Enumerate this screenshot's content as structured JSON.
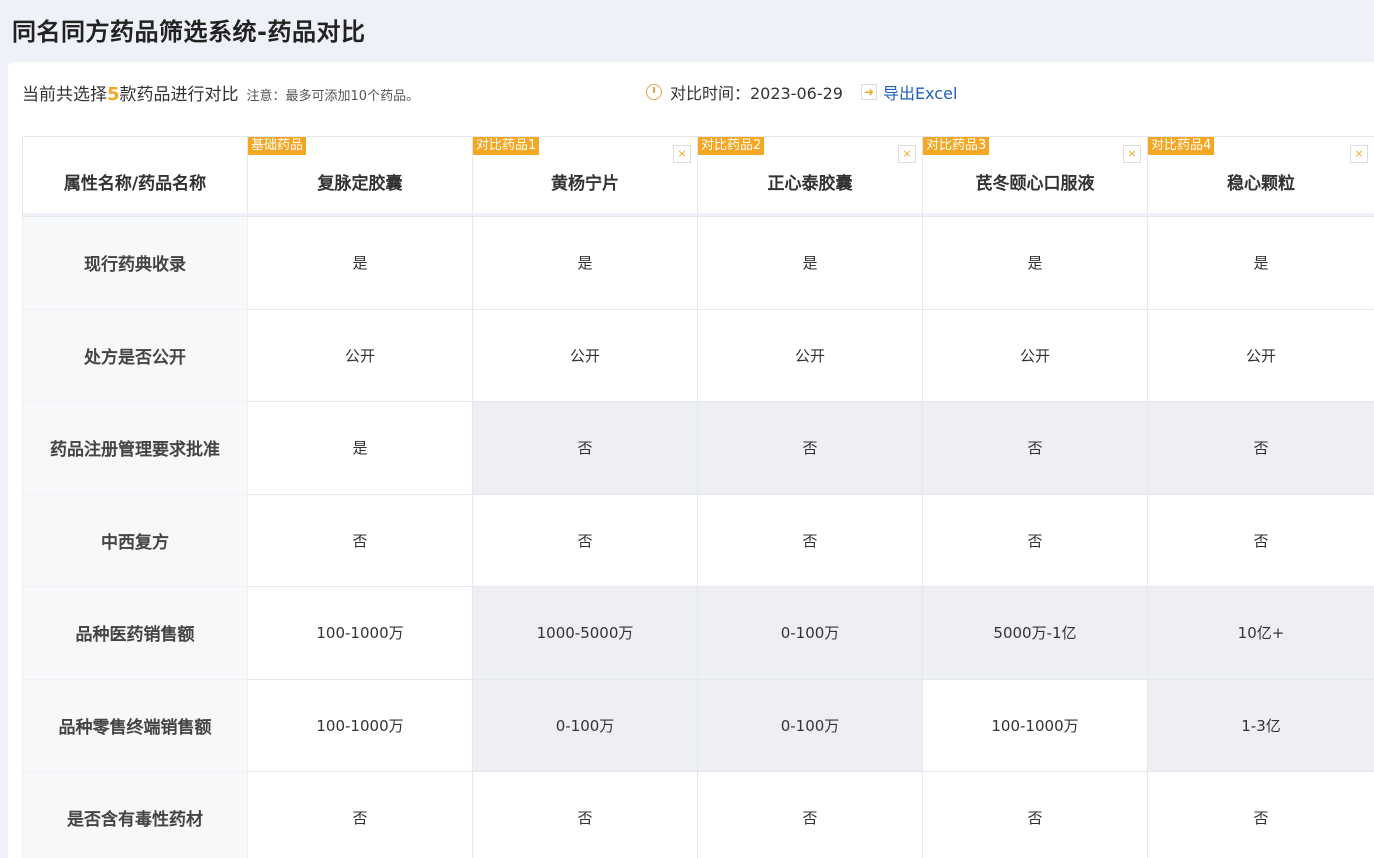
{
  "page_title": "同名同方药品筛选系统-药品对比",
  "info": {
    "prefix": "当前共选择",
    "count": "5",
    "suffix": "款药品进行对比",
    "note": "注意：最多可添加10个药品。",
    "time_label": "对比时间：2023-06-29",
    "export_label": "导出Excel"
  },
  "table": {
    "attr_header": "属性名称/药品名称",
    "drugs": [
      {
        "tag": "基础药品",
        "name": "复脉定胶囊",
        "removable": false
      },
      {
        "tag": "对比药品1",
        "name": "黄杨宁片",
        "removable": true
      },
      {
        "tag": "对比药品2",
        "name": "正心泰胶囊",
        "removable": true
      },
      {
        "tag": "对比药品3",
        "name": "芪冬颐心口服液",
        "removable": true
      },
      {
        "tag": "对比药品4",
        "name": "稳心颗粒",
        "removable": true
      }
    ],
    "close_symbol": "×",
    "rows": [
      {
        "label": "现行药典收录",
        "values": [
          "是",
          "是",
          "是",
          "是",
          "是"
        ],
        "diff": [
          false,
          false,
          false,
          false,
          false
        ]
      },
      {
        "label": "处方是否公开",
        "values": [
          "公开",
          "公开",
          "公开",
          "公开",
          "公开"
        ],
        "diff": [
          false,
          false,
          false,
          false,
          false
        ]
      },
      {
        "label": "药品注册管理要求批准",
        "values": [
          "是",
          "否",
          "否",
          "否",
          "否"
        ],
        "diff": [
          false,
          true,
          true,
          true,
          true
        ]
      },
      {
        "label": "中西复方",
        "values": [
          "否",
          "否",
          "否",
          "否",
          "否"
        ],
        "diff": [
          false,
          false,
          false,
          false,
          false
        ]
      },
      {
        "label": "品种医药销售额",
        "values": [
          "100-1000万",
          "1000-5000万",
          "0-100万",
          "5000万-1亿",
          "10亿+"
        ],
        "diff": [
          false,
          true,
          true,
          true,
          true
        ]
      },
      {
        "label": "品种零售终端销售额",
        "values": [
          "100-1000万",
          "0-100万",
          "0-100万",
          "100-1000万",
          "1-3亿"
        ],
        "diff": [
          false,
          true,
          true,
          false,
          true
        ]
      },
      {
        "label": "是否含有毒性药材",
        "values": [
          "否",
          "否",
          "否",
          "否",
          "否"
        ],
        "diff": [
          false,
          false,
          false,
          false,
          false
        ]
      }
    ]
  },
  "colors": {
    "accent": "#f5a623",
    "link": "#1f5fb8",
    "diff_bg": "#edeff3"
  }
}
